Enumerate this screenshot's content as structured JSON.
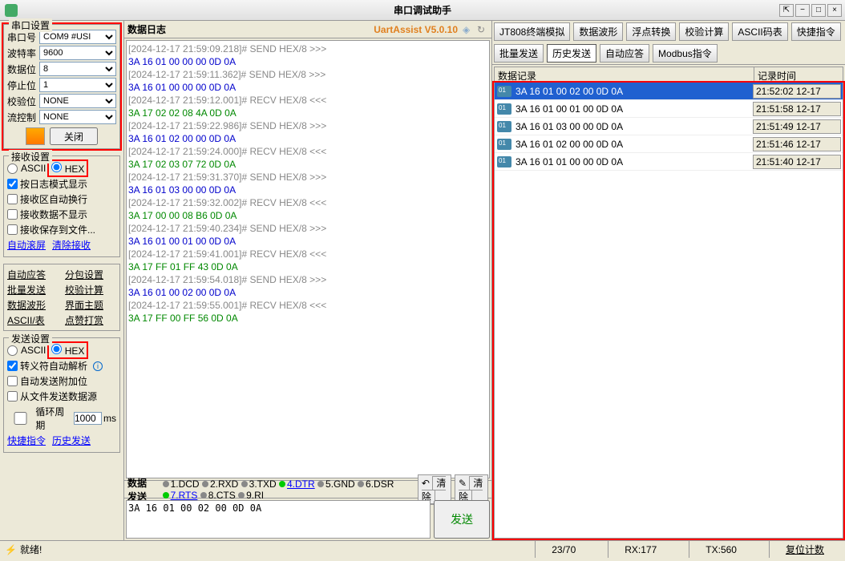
{
  "window": {
    "title": "串口调试助手"
  },
  "brand": "UartAssist V5.0.10",
  "tabs": {
    "left": [
      "JT808终端模拟",
      "数据波形",
      "浮点转换",
      "校验计算",
      "ASCII码表",
      "快捷指令",
      "批量发送",
      "历史发送",
      "自动应答",
      "Modbus指令"
    ],
    "active": "历史发送"
  },
  "port_panel": {
    "title": "串口设置",
    "rows": [
      {
        "label": "串口号",
        "value": "COM9 #USI"
      },
      {
        "label": "波特率",
        "value": "9600"
      },
      {
        "label": "数据位",
        "value": "8"
      },
      {
        "label": "停止位",
        "value": "1"
      },
      {
        "label": "校验位",
        "value": "NONE"
      },
      {
        "label": "流控制",
        "value": "NONE"
      }
    ],
    "close_btn": "关闭"
  },
  "recv_panel": {
    "title": "接收设置",
    "ascii": "ASCII",
    "hex": "HEX",
    "chk1": "按日志模式显示",
    "chk2": "接收区自动换行",
    "chk3": "接收数据不显示",
    "chk4": "接收保存到文件...",
    "link1": "自动滚屏",
    "link2": "清除接收"
  },
  "misc_links": [
    "自动应答",
    "分包设置",
    "批量发送",
    "校验计算",
    "数据波形",
    "界面主题",
    "ASCII/表",
    "点赞打赏"
  ],
  "send_panel": {
    "title": "发送设置",
    "ascii": "ASCII",
    "hex": "HEX",
    "chk1": "转义符自动解析",
    "chk2": "自动发送附加位",
    "chk3": "从文件发送数据源",
    "cycle_label": "循环周期",
    "cycle_val": "1000",
    "cycle_unit": "ms",
    "link1": "快捷指令",
    "link2": "历史发送"
  },
  "log_title": "数据日志",
  "log": [
    {
      "ts": "[2024-12-17 21:59:09.218]# SEND HEX/8",
      "sym": ">>>",
      "d": "3A 16 01 00 00 00 0D 0A",
      "t": "send"
    },
    {
      "ts": "[2024-12-17 21:59:11.362]# SEND HEX/8",
      "sym": ">>>",
      "d": "3A 16 01 00 00 00 0D 0A",
      "t": "send"
    },
    {
      "ts": "[2024-12-17 21:59:12.001]# RECV HEX/8",
      "sym": "<<<",
      "d": "3A 17 02 02 08 4A 0D 0A",
      "t": "recv"
    },
    {
      "ts": "[2024-12-17 21:59:22.986]# SEND HEX/8",
      "sym": ">>>",
      "d": "3A 16 01 02 00 00 0D 0A",
      "t": "send"
    },
    {
      "ts": "[2024-12-17 21:59:24.000]# RECV HEX/8",
      "sym": "<<<",
      "d": "3A 17 02 03 07 72 0D 0A",
      "t": "recv"
    },
    {
      "ts": "[2024-12-17 21:59:31.370]# SEND HEX/8",
      "sym": ">>>",
      "d": "3A 16 01 03 00 00 0D 0A",
      "t": "send"
    },
    {
      "ts": "[2024-12-17 21:59:32.002]# RECV HEX/8",
      "sym": "<<<",
      "d": "3A 17 00 00 08 B6 0D 0A",
      "t": "recv"
    },
    {
      "ts": "[2024-12-17 21:59:40.234]# SEND HEX/8",
      "sym": ">>>",
      "d": "3A 16 01 00 01 00 0D 0A",
      "t": "send"
    },
    {
      "ts": "[2024-12-17 21:59:41.001]# RECV HEX/8",
      "sym": "<<<",
      "d": "3A 17 FF 01 FF 43 0D 0A",
      "t": "recv"
    },
    {
      "ts": "[2024-12-17 21:59:54.018]# SEND HEX/8",
      "sym": ">>>",
      "d": "3A 16 01 00 02 00 0D 0A",
      "t": "send"
    },
    {
      "ts": "[2024-12-17 21:59:55.001]# RECV HEX/8",
      "sym": "<<<",
      "d": "3A 17 FF 00 FF 56 0D 0A",
      "t": "recv"
    }
  ],
  "history": {
    "col1": "数据记录",
    "col2": "记录时间",
    "rows": [
      {
        "data": "3A 16 01 00 02 00 0D 0A",
        "time": "21:52:02 12-17",
        "sel": true
      },
      {
        "data": "3A 16 01 00 01 00 0D 0A",
        "time": "21:51:58 12-17"
      },
      {
        "data": "3A 16 01 03 00 00 0D 0A",
        "time": "21:51:49 12-17"
      },
      {
        "data": "3A 16 01 02 00 00 0D 0A",
        "time": "21:51:46 12-17"
      },
      {
        "data": "3A 16 01 01 00 00 0D 0A",
        "time": "21:51:40 12-17"
      }
    ]
  },
  "sendbox": {
    "tab": "数据发送",
    "sigs": [
      "1.DCD",
      "2.RXD",
      "3.TXD",
      "4.DTR",
      "5.GND",
      "6.DSR",
      "7.RTS",
      "8.CTS",
      "9.RI"
    ],
    "on": [
      3,
      6
    ],
    "clear_r": "清除",
    "clear_l": "清除",
    "value": "3A 16 01 00 02 00 0D 0A",
    "send_btn": "发送"
  },
  "status": {
    "ready": "就绪!",
    "pages": "23/70",
    "rx": "RX:177",
    "tx": "TX:560",
    "reset": "复位计数"
  }
}
